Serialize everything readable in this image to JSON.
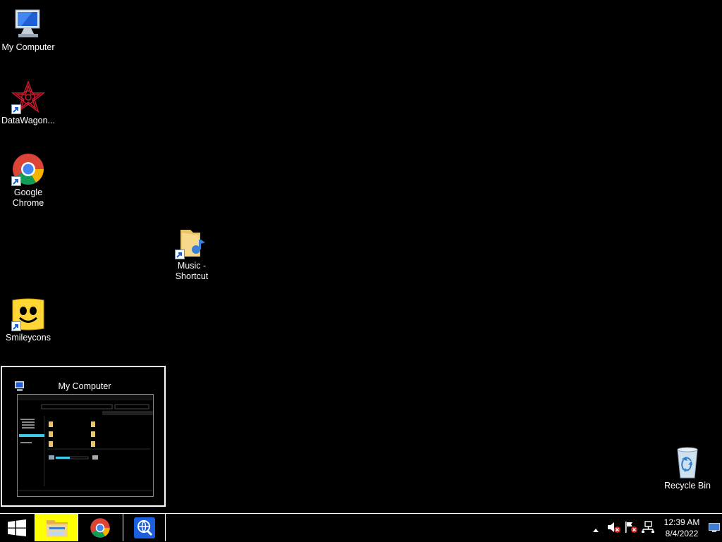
{
  "desktop": {
    "icons": [
      {
        "label": "My Computer",
        "icon": "computer-icon"
      },
      {
        "label": "DataWagon...",
        "icon": "datawagon-icon"
      },
      {
        "label": "Google Chrome",
        "icon": "chrome-icon"
      },
      {
        "label": "Music - Shortcut",
        "icon": "music-folder-icon"
      },
      {
        "label": "Smileycons",
        "icon": "smiley-icon"
      },
      {
        "label": "Recycle Bin",
        "icon": "recycle-bin-icon"
      }
    ]
  },
  "preview": {
    "title": "My Computer"
  },
  "taskbar": {
    "buttons": [
      {
        "name": "start",
        "icon": "windows-logo-icon"
      },
      {
        "name": "file-explorer",
        "icon": "file-explorer-icon",
        "active": true
      },
      {
        "name": "chrome",
        "icon": "chrome-icon"
      },
      {
        "name": "browser-app",
        "icon": "globe-search-icon"
      }
    ],
    "clock": {
      "time": "12:39 AM",
      "date": "8/4/2022"
    }
  },
  "colors": {
    "background": "#000000",
    "taskbar_active": "#ffff00",
    "accent": "#1e90ff"
  }
}
